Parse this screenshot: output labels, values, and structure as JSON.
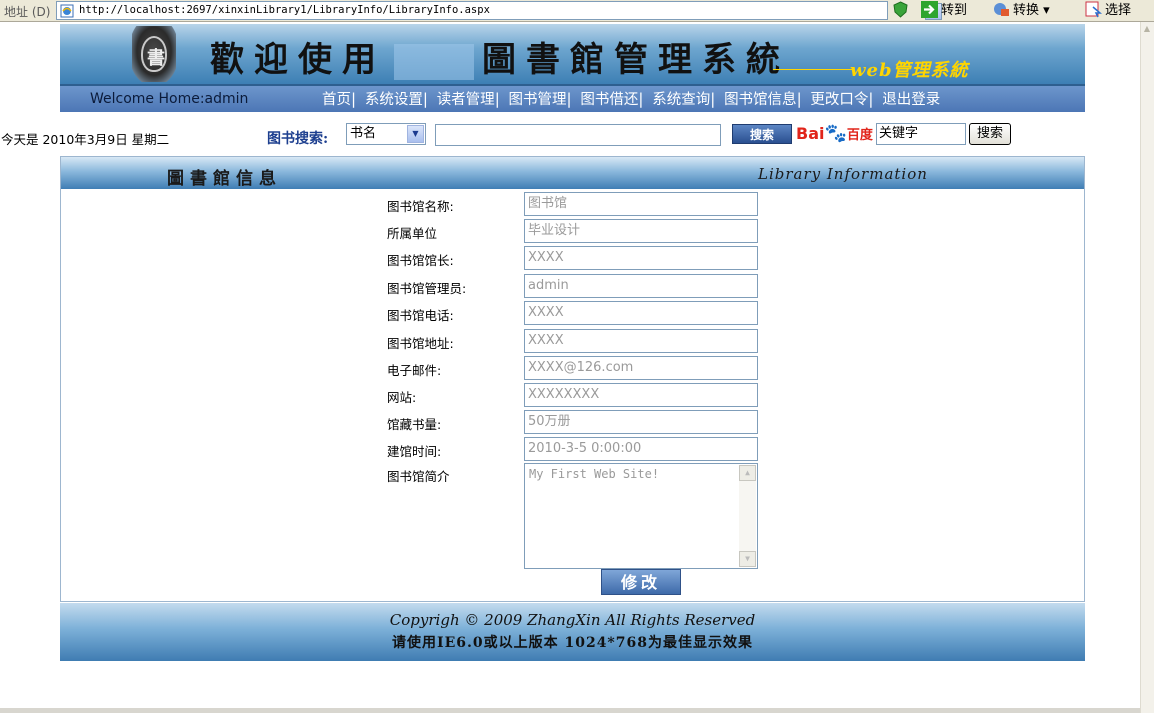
{
  "browser": {
    "address_label": "地址 (D)",
    "url": "http://localhost:2697/xinxinLibrary1/LibraryInfo/LibraryInfo.aspx",
    "go_label": "转到",
    "convert_label": "转换",
    "select_label": "选择"
  },
  "banner": {
    "seal_char": "書",
    "title_left": "歡迎使用",
    "title_right": "圖書館管理系統",
    "subtitle": "web管理系統"
  },
  "nav": {
    "welcome": "Welcome Home:admin",
    "items": [
      {
        "label": "首页"
      },
      {
        "label": "系统设置"
      },
      {
        "label": "读者管理"
      },
      {
        "label": "图书管理"
      },
      {
        "label": "图书借还"
      },
      {
        "label": "系统查询"
      },
      {
        "label": "图书馆信息"
      },
      {
        "label": "更改口令"
      },
      {
        "label": "退出登录"
      }
    ]
  },
  "search": {
    "date": "今天是 2010年3月9日 星期二",
    "label": "图书搜索:",
    "field_selected": "书名",
    "query_value": "",
    "button_label": "搜索",
    "baidu_bai": "Bai",
    "baidu_paw": "🐾",
    "baidu_du": "百度",
    "keyword_value": "关键字",
    "keyword_button": "搜索"
  },
  "panel": {
    "title": "圖書館信息",
    "title_en": "Library Information"
  },
  "form": {
    "rows": [
      {
        "label": "图书馆名称:",
        "value": "图书馆"
      },
      {
        "label": "所属单位",
        "value": "毕业设计"
      },
      {
        "label": "图书馆馆长:",
        "value": "XXXX"
      },
      {
        "label": "图书馆管理员:",
        "value": "admin"
      },
      {
        "label": "图书馆电话:",
        "value": "XXXX"
      },
      {
        "label": "图书馆地址:",
        "value": "XXXX"
      },
      {
        "label": "电子邮件:",
        "value": "XXXX@126.com"
      },
      {
        "label": "网站:",
        "value": "XXXXXXXX"
      },
      {
        "label": "馆藏书量:",
        "value": "50万册"
      },
      {
        "label": "建馆时间:",
        "value": "2010-3-5 0:00:00"
      }
    ],
    "intro_label": "图书馆简介",
    "intro_value": "My First Web Site!",
    "modify_label": "修改"
  },
  "footer": {
    "copyright": "Copyrigh © 2009 ZhangXin    All Rights Reserved",
    "hint": "请使用IE6.0或以上版本 1024*768为最佳显示效果"
  },
  "colors": {
    "banner_blue": "#3d7fb4",
    "nav_blue": "#4c76b5",
    "accent_yellow": "#ffd500"
  }
}
